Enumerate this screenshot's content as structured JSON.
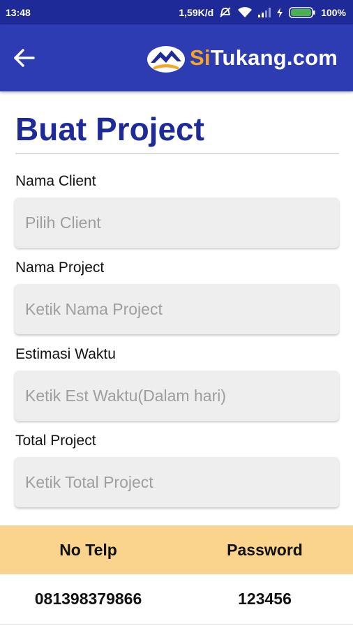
{
  "status_bar": {
    "time": "13:48",
    "net_speed": "1,59K/d",
    "battery": "100%"
  },
  "app_bar": {
    "logo_prefix": "Si",
    "logo_suffix": "Tukang.com",
    "colors": {
      "bar": "#2e3cb3",
      "accent": "#f5a623"
    }
  },
  "page": {
    "title": "Buat Project"
  },
  "form": {
    "client": {
      "label": "Nama Client",
      "placeholder": "Pilih Client"
    },
    "project": {
      "label": "Nama Project",
      "placeholder": "Ketik Nama Project"
    },
    "estimate": {
      "label": "Estimasi Waktu",
      "placeholder": "Ketik Est Waktu(Dalam hari)"
    },
    "total": {
      "label": "Total Project",
      "placeholder": "Ketik Total Project"
    }
  },
  "table": {
    "headers": [
      "No Telp",
      "Password"
    ],
    "rows": [
      [
        "081398379866",
        "123456"
      ]
    ],
    "header_color": "#fad48c"
  }
}
